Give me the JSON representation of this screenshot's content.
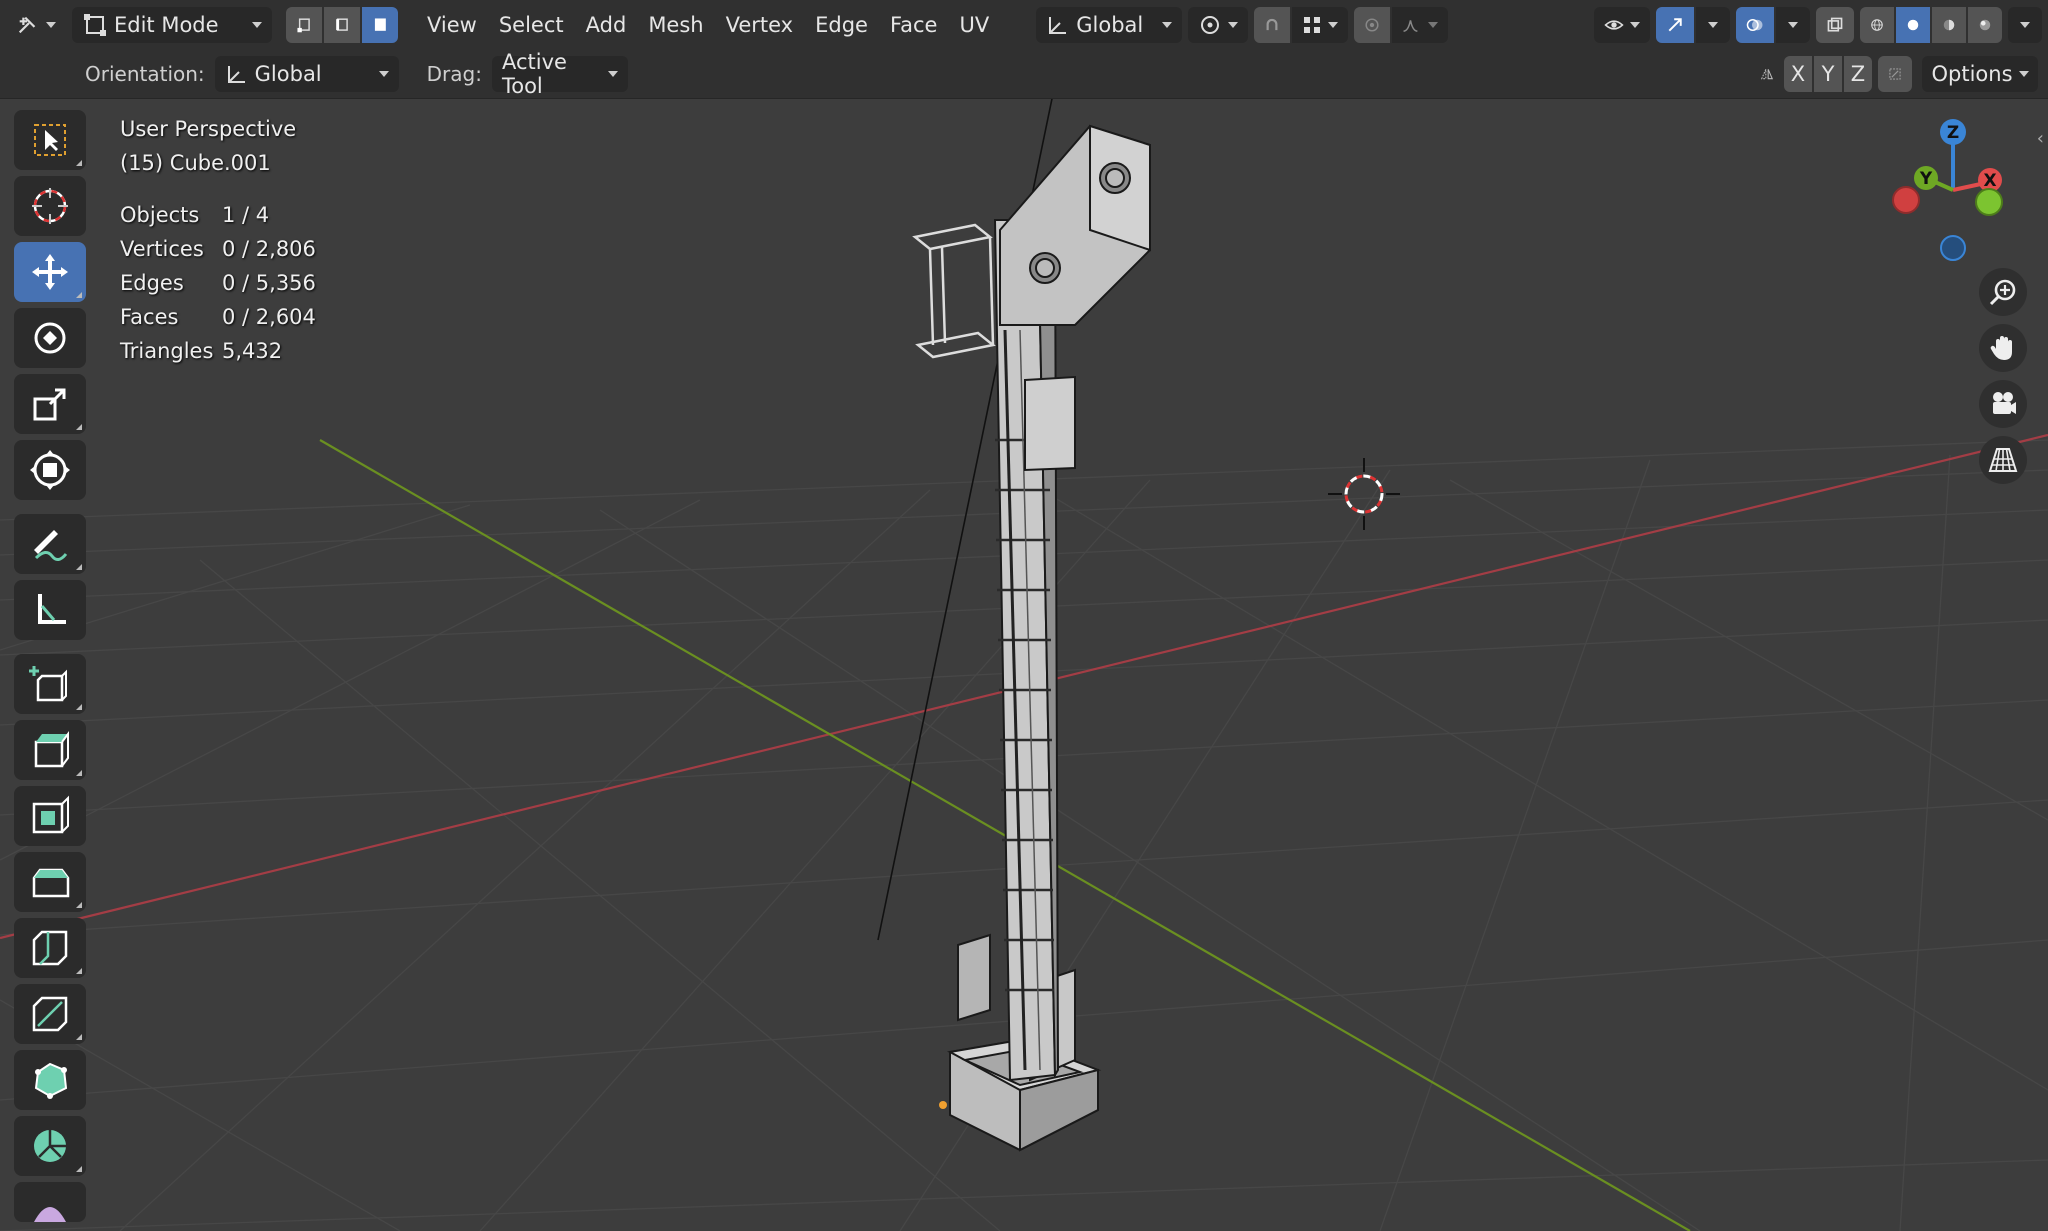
{
  "header": {
    "mode_label": "Edit Mode",
    "menus": [
      "View",
      "Select",
      "Add",
      "Mesh",
      "Vertex",
      "Edge",
      "Face",
      "UV"
    ],
    "transform_orientation": "Global"
  },
  "tool_settings": {
    "orientation_label": "Orientation:",
    "orientation_value": "Global",
    "drag_label": "Drag:",
    "drag_value": "Active Tool",
    "axis_x": "X",
    "axis_y": "Y",
    "axis_z": "Z",
    "options_label": "Options"
  },
  "viewport": {
    "view_name": "User Perspective",
    "object_name": "(15) Cube.001",
    "stats": [
      {
        "label": "Objects",
        "value": "1 / 4"
      },
      {
        "label": "Vertices",
        "value": "0 / 2,806"
      },
      {
        "label": "Edges",
        "value": "0 / 5,356"
      },
      {
        "label": "Faces",
        "value": "0 / 2,604"
      },
      {
        "label": "Triangles",
        "value": "5,432"
      }
    ]
  },
  "gizmo": {
    "x": "X",
    "y": "Y",
    "z": "Z",
    "x_color": "#e14c4c",
    "y_color": "#6ea824",
    "z_color": "#3a85d6"
  },
  "colors": {
    "accent": "#4772b3",
    "x_axis": "#a33d45",
    "y_axis": "#6a8f21"
  },
  "toolbar_icons": [
    "select-box-icon",
    "cursor-icon",
    "move-icon",
    "rotate-icon",
    "scale-icon",
    "transform-icon",
    "annotate-icon",
    "measure-icon",
    "add-cube-icon",
    "extrude-icon",
    "inset-icon",
    "bevel-icon",
    "loop-cut-icon",
    "knife-icon",
    "poly-build-icon",
    "spin-icon",
    "smooth-icon"
  ]
}
